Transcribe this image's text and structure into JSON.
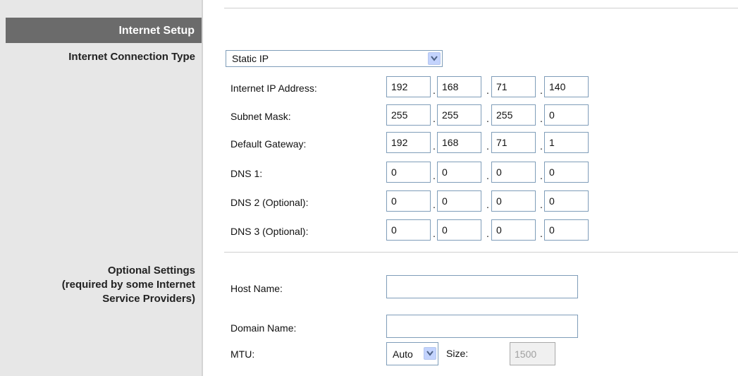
{
  "section_title": "Internet Setup",
  "connection_type": {
    "label": "Internet Connection Type",
    "selected": "Static IP"
  },
  "static_ip": [
    {
      "label": "Internet IP Address:",
      "octets": [
        "192",
        "168",
        "71",
        "140"
      ]
    },
    {
      "label": "Subnet Mask:",
      "octets": [
        "255",
        "255",
        "255",
        "0"
      ]
    },
    {
      "label": "Default Gateway:",
      "octets": [
        "192",
        "168",
        "71",
        "1"
      ]
    },
    {
      "label": "DNS 1:",
      "octets": [
        "0",
        "0",
        "0",
        "0"
      ]
    },
    {
      "label": "DNS 2 (Optional):",
      "octets": [
        "0",
        "0",
        "0",
        "0"
      ]
    },
    {
      "label": "DNS 3 (Optional):",
      "octets": [
        "0",
        "0",
        "0",
        "0"
      ]
    }
  ],
  "optional": {
    "label_lines": [
      "Optional Settings",
      "(required by some Internet",
      "Service Providers)"
    ],
    "host_name": {
      "label": "Host Name:",
      "value": ""
    },
    "domain_name": {
      "label": "Domain Name:",
      "value": ""
    },
    "mtu": {
      "label": "MTU:",
      "selected": "Auto",
      "size_label": "Size:",
      "size_value": "1500"
    }
  }
}
